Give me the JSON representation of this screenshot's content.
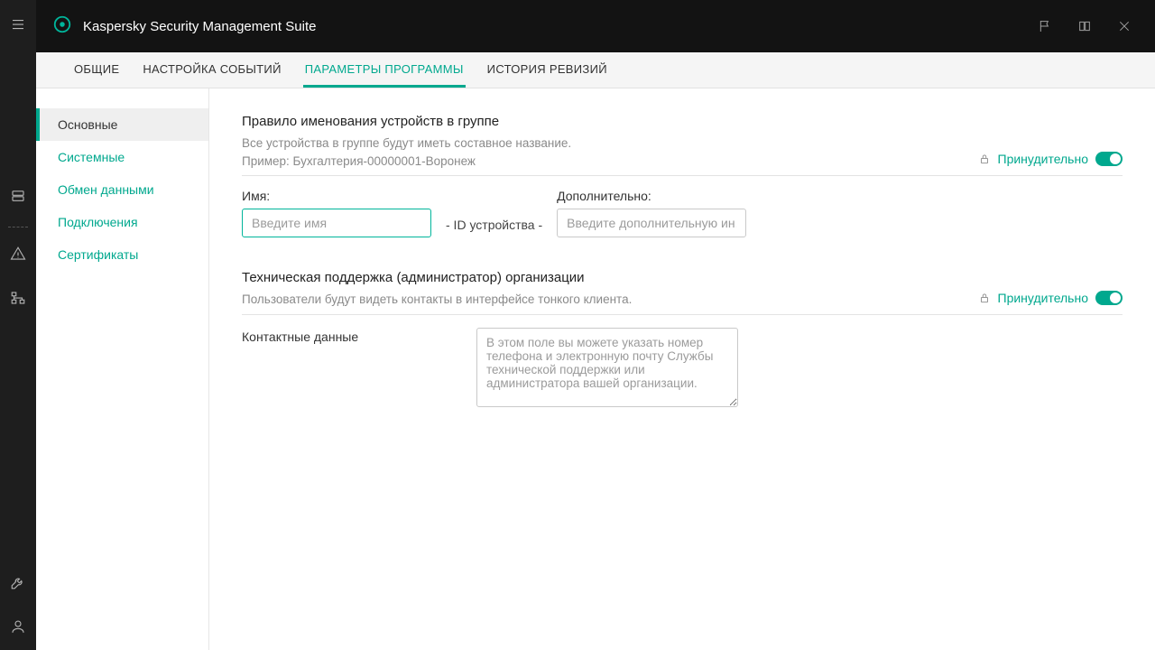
{
  "titlebar": {
    "title": "Kaspersky Security Management Suite"
  },
  "tabs": [
    {
      "label": "ОБЩИЕ"
    },
    {
      "label": "НАСТРОЙКА СОБЫТИЙ"
    },
    {
      "label": "ПАРАМЕТРЫ ПРОГРАММЫ"
    },
    {
      "label": "ИСТОРИЯ РЕВИЗИЙ"
    }
  ],
  "sidenav": [
    {
      "label": "Основные"
    },
    {
      "label": "Системные"
    },
    {
      "label": "Обмен данными"
    },
    {
      "label": "Подключения"
    },
    {
      "label": "Сертификаты"
    }
  ],
  "enforce_label": "Принудительно",
  "section_naming": {
    "title": "Правило именования устройств в группе",
    "desc1": "Все устройства в группе будут иметь составное название.",
    "desc2": "Пример: Бухгалтерия-00000001-Воронеж",
    "name_label": "Имя:",
    "name_placeholder": "Введите имя",
    "joiner": "- ID устройства -",
    "extra_label": "Дополнительно:",
    "extra_placeholder": "Введите дополнительную ин..."
  },
  "section_support": {
    "title": "Техническая поддержка (администратор) организации",
    "desc": "Пользователи будут видеть контакты в интерфейсе тонкого клиента.",
    "contact_label": "Контактные данные",
    "contact_placeholder": "В этом поле вы можете указать номер телефона и электронную почту Службы технической поддержки или администратора вашей организации."
  }
}
